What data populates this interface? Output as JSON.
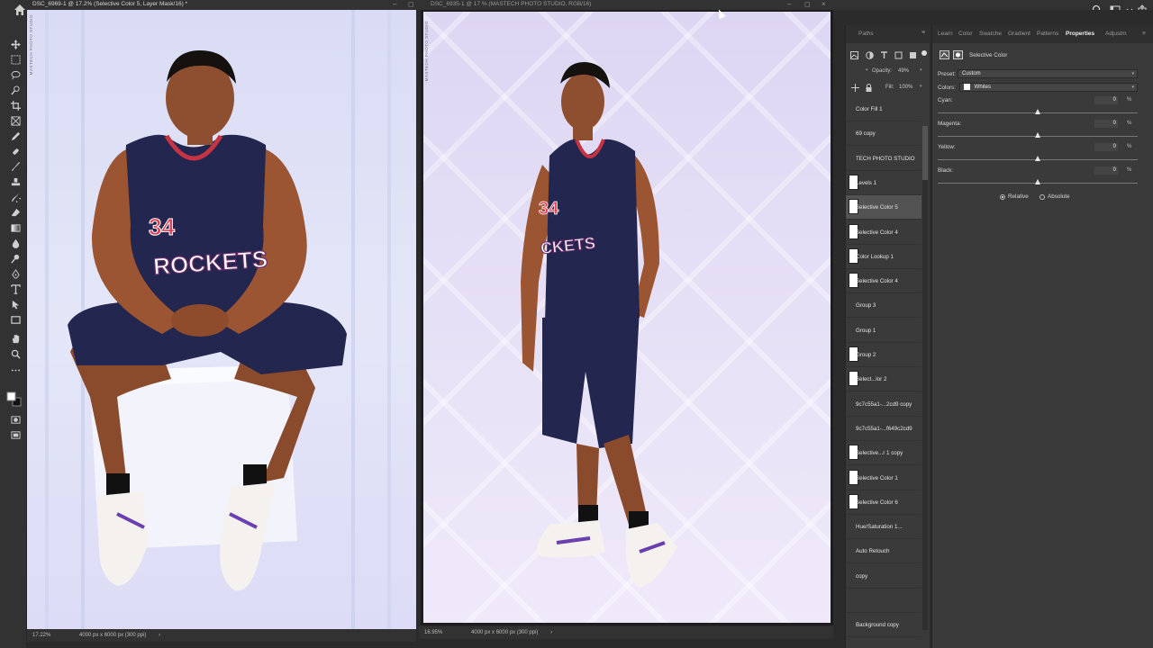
{
  "window": {
    "left_doc_title": "DSC_6969-1 @ 17.2% (Selective Color 5, Layer Mask/16) *",
    "right_doc_title": "DSC_6935-1 @ 17 % (MASTECH PHOTO STUDIO, RGB/16)",
    "studio_watermark": "MASTECH PHOTO STUDIO"
  },
  "docs": {
    "left": {
      "zoom": "17.22%",
      "size": "4000 px x 6000 px (300 ppi)"
    },
    "right": {
      "zoom": "16.95%",
      "size": "4000 px x 6000 px (300 ppi)"
    }
  },
  "layers": {
    "tab_label": "Paths",
    "opacity_label": "Opacity:",
    "opacity_value": "49%",
    "fill_label": "Fill:",
    "fill_value": "100%",
    "items": [
      {
        "name": "Color Fill 1",
        "thumb": false
      },
      {
        "name": "69 copy",
        "thumb": false
      },
      {
        "name": "TECH PHOTO STUDIO",
        "thumb": false
      },
      {
        "name": "Levels 1",
        "thumb": true
      },
      {
        "name": "Selective Color 5",
        "thumb": true,
        "selected": true
      },
      {
        "name": "Selective Color 4",
        "thumb": true
      },
      {
        "name": "Color Lookup 1",
        "thumb": true
      },
      {
        "name": "Selective Color 4",
        "thumb": true
      },
      {
        "name": "Group 3",
        "thumb": false
      },
      {
        "name": "Group 1",
        "thumb": false
      },
      {
        "name": "Group 2",
        "thumb": true
      },
      {
        "name": "Select...lor 2",
        "thumb": true
      },
      {
        "name": "9c7c55a1-...2cd9 copy",
        "thumb": false
      },
      {
        "name": "9c7c55a1-...f649c2cd9",
        "thumb": false
      },
      {
        "name": "Selective...r 1 copy",
        "thumb": true
      },
      {
        "name": "Selective Color 1",
        "thumb": true
      },
      {
        "name": "Selective Color 6",
        "thumb": true
      },
      {
        "name": "Hue/Saturation 1...",
        "thumb": false
      },
      {
        "name": "Auto Retouch",
        "thumb": false
      },
      {
        "name": "copy",
        "thumb": false
      },
      {
        "name": "",
        "thumb": false
      },
      {
        "name": "Background copy",
        "thumb": false
      }
    ]
  },
  "properties": {
    "tabs": [
      "Learn",
      "Color",
      "Swatche",
      "Gradient",
      "Patterns",
      "Properties",
      "Adjustm"
    ],
    "active_tab": "Properties",
    "panel_title": "Selective Color",
    "preset_label": "Preset:",
    "preset_value": "Custom",
    "colors_label": "Colors:",
    "colors_value": "Whites",
    "sliders": [
      {
        "label": "Cyan:",
        "value": "0",
        "position": 0.5
      },
      {
        "label": "Magenta:",
        "value": "0",
        "position": 0.5
      },
      {
        "label": "Yellow:",
        "value": "0",
        "position": 0.5
      },
      {
        "label": "Black:",
        "value": "0",
        "position": 0.5
      }
    ],
    "pct_sign": "%",
    "method_relative": "Relative",
    "method_absolute": "Absolute",
    "method_selected": "Relative"
  }
}
